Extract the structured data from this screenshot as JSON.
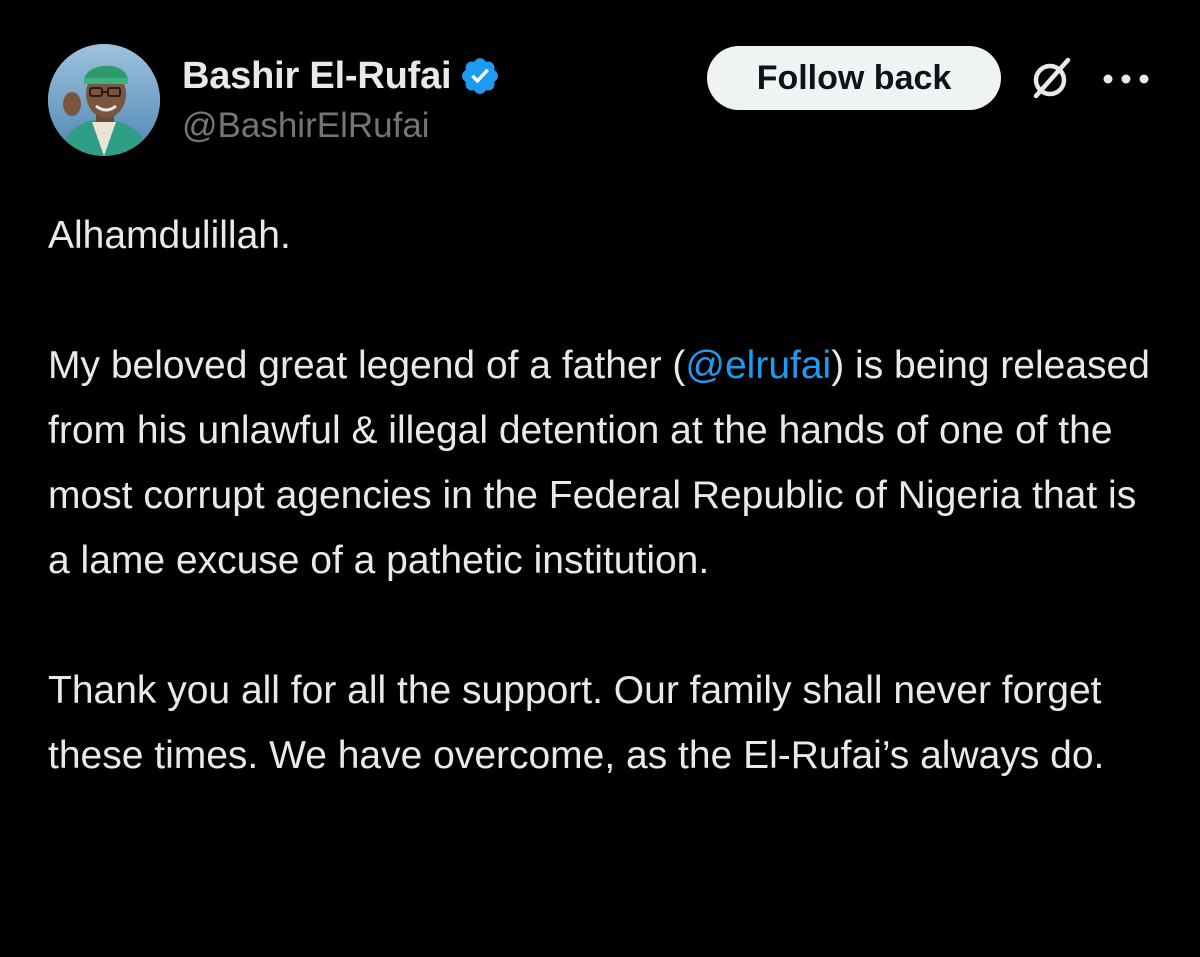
{
  "author": {
    "display_name": "Bashir El-Rufai",
    "handle": "@BashirElRufai",
    "verified": true,
    "verified_color": "#1d9bf0"
  },
  "actions": {
    "follow_label": "Follow back",
    "grok_icon": "grok-icon",
    "more_icon": "more-options-icon"
  },
  "post": {
    "line1": "Alhamdulillah.",
    "para2_before": "My beloved great legend of a father (",
    "para2_mention": "@elrufai",
    "para2_after": ") is being released from his unlawful & illegal detention at the hands of one of the most corrupt agencies in the Federal Republic of Nigeria that is a lame excuse of a pathetic institution.",
    "para3": "Thank you all for all the support. Our family shall never forget these times. We have overcome, as the El-Rufai’s always do."
  },
  "colors": {
    "background": "#000000",
    "text": "#e7e9ea",
    "secondary_text": "#71767b",
    "link": "#1d9bf0",
    "button_bg": "#eff3f4"
  }
}
